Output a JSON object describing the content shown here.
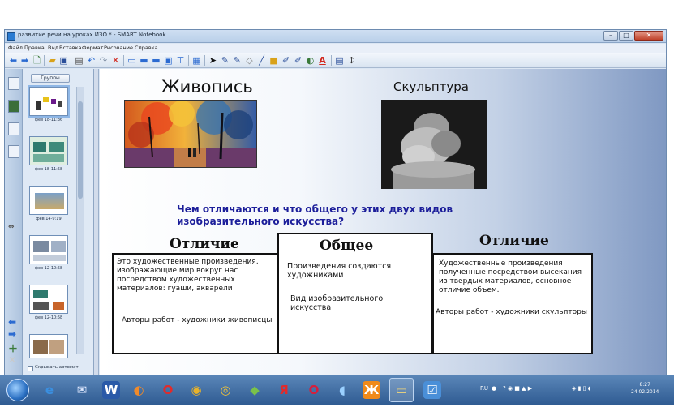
{
  "window": {
    "title": "развитие речи на уроках ИЗО * - SMART Notebook",
    "minimize": "–",
    "maximize": "□",
    "close": "✕"
  },
  "menu": [
    "Файл",
    "Правка",
    "Вид",
    "Вставка",
    "Формат",
    "Рисование",
    "Справка"
  ],
  "sorter": {
    "groups_label": "Группы",
    "thumbnails": [
      {
        "label": "фев 18-11:36"
      },
      {
        "label": "фев 18-11:58"
      },
      {
        "label": "фев 14-9:19"
      },
      {
        "label": "фев 12-10:58"
      },
      {
        "label": "фев 12-10:58"
      },
      {
        "label": ""
      }
    ],
    "hide_label": "Скрывать автомат"
  },
  "slide": {
    "title_painting": "Живопись",
    "title_sculpture": "Скульптура",
    "question": "Чем отличаются и что общего у этих двух видов изобразительного искусства?",
    "left": {
      "heading": "Отличие",
      "text": "Это художественные произведения, изображающие мир вокруг нас посредством художественных материалов: гуаши, акварели",
      "authors": "Авторы работ - художники живописцы"
    },
    "center": {
      "heading": "Общее",
      "text1": "Произведения создаются художниками",
      "text2": "Вид изобразительного искусства"
    },
    "right": {
      "heading": "Отличие",
      "text": "Художественные произведения полученные посредством высекания из твердых материалов, основное отличие объем.",
      "authors": "Авторы работ - художники скульпторы"
    }
  },
  "taskbar": {
    "lang": "RU",
    "time": "8:27",
    "date": "24.02.2014"
  },
  "colors": {
    "question": "#1c1e9a",
    "taskbar": "#2f5b92"
  }
}
